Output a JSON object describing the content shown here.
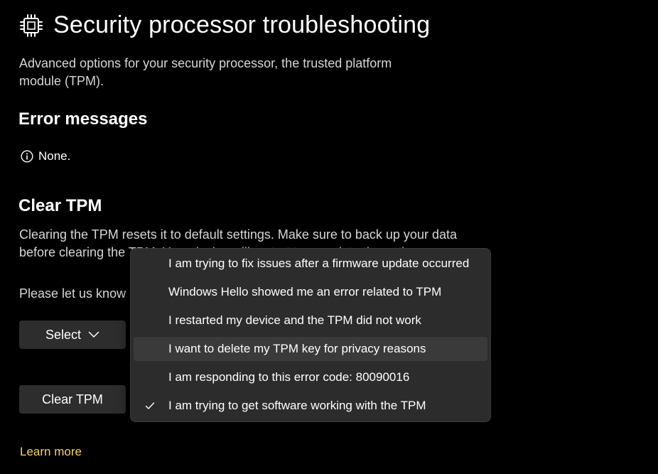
{
  "page": {
    "title": "Security processor troubleshooting",
    "subtitle": "Advanced options for your security processor, the trusted platform module (TPM).",
    "icon": "chip-icon"
  },
  "errors": {
    "heading": "Error messages",
    "status": "None.",
    "icon": "info-icon"
  },
  "clear": {
    "heading": "Clear TPM",
    "description": "Clearing the TPM resets it to default settings. Make sure to back up your data before clearing the TPM. Your device will restart to complete the action.",
    "ask": "Please let us know",
    "select_label": "Select",
    "clear_label": "Clear TPM"
  },
  "dropdown": {
    "items": [
      {
        "label": "I am trying to fix issues after a firmware update occurred"
      },
      {
        "label": "Windows Hello showed me an error related to TPM"
      },
      {
        "label": "I restarted my device and the TPM did not work"
      },
      {
        "label": "I want to delete my TPM key for privacy reasons"
      },
      {
        "label": "I am responding to this error code: 80090016"
      },
      {
        "label": "I am trying to get software working with the TPM"
      }
    ],
    "hovered_index": 3,
    "checked_index": 5
  },
  "footer": {
    "learn_more": "Learn more"
  },
  "colors": {
    "background": "#000000",
    "link": "#f3d36b",
    "button": "#2d2d2d",
    "menu": "#2c2c2c"
  }
}
